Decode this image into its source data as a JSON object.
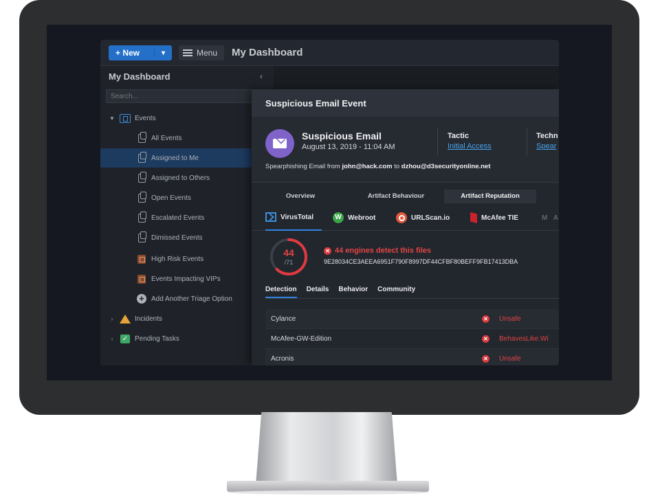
{
  "topbar": {
    "new_label": "+ New",
    "new_caret": "▾",
    "menu_label": "Menu",
    "title": "My Dashboard"
  },
  "sidebar": {
    "heading": "My Dashboard",
    "collapse_icon": "‹",
    "search_placeholder": "Search...",
    "items": [
      {
        "label": "Events",
        "icon": "calendar-icon",
        "expanded": true
      },
      {
        "label": "All Events",
        "icon": "copy-icon"
      },
      {
        "label": "Assigned to Me",
        "icon": "copy-icon",
        "active": true
      },
      {
        "label": "Assigned to Others",
        "icon": "copy-icon"
      },
      {
        "label": "Open Events",
        "icon": "copy-icon"
      },
      {
        "label": "Escalated Events",
        "icon": "copy-icon"
      },
      {
        "label": "Dimissed Events",
        "icon": "copy-icon"
      },
      {
        "label": "High Risk Events",
        "icon": "risk-icon"
      },
      {
        "label": "Events Impacting VIPs",
        "icon": "risk-icon"
      },
      {
        "label": "Add Another Triage Option",
        "icon": "plus-circle-icon"
      },
      {
        "label": "Incidents",
        "icon": "warning-icon"
      },
      {
        "label": "Pending Tasks",
        "icon": "check-icon"
      }
    ]
  },
  "modal": {
    "header": "Suspicious Email Event",
    "event_title": "Suspicious Email",
    "event_date": "August 13, 2019 - 11:04 AM",
    "tactic_label": "Tactic",
    "tactic_value": "Initial Access",
    "technique_label": "Techn",
    "technique_value": "Spear",
    "desc_prefix": "Spearphishing Email from ",
    "desc_from": "john@hack.com",
    "desc_mid": " to ",
    "desc_to": "dzhou@d3securityonline.net",
    "tabs": [
      "Overview",
      "Artifact Behaviour",
      "Artifact Reputation"
    ],
    "active_tab": "Artifact Reputation",
    "vendors": [
      "VirusTotal",
      "Webroot",
      "URLScan.io",
      "McAfee TIE",
      "M A"
    ],
    "active_vendor": "VirusTotal",
    "score": "44",
    "score_total": "/71",
    "score_fraction": 0.62,
    "detect_text": "44 engines detect this files",
    "hash": "9E28034CE3AEEA6951F790F8997DF44CFBF80BEFF9FB17413DBA",
    "subtabs": [
      "Detection",
      "Details",
      "Behavior",
      "Community"
    ],
    "detections": [
      {
        "engine": "Cylance",
        "result": "Unsafe"
      },
      {
        "engine": "McAfee-GW-Edition",
        "result": "BehavesLike.Wi"
      },
      {
        "engine": "Acronis",
        "result": "Unsafe"
      }
    ]
  },
  "colors": {
    "accent": "#2470c9",
    "danger": "#e24545",
    "link": "#4aa3ef",
    "event_icon": "#7f63c9"
  }
}
